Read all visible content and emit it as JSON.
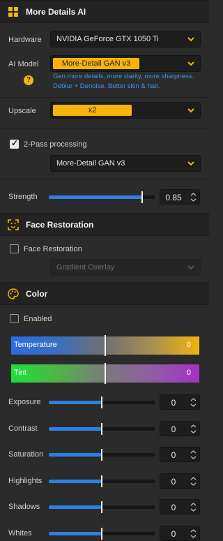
{
  "sections": {
    "details": {
      "title": "More Details AI",
      "icon": "grid-icon"
    },
    "face": {
      "title": "Face Restoration",
      "icon": "face-scan-icon"
    },
    "color": {
      "title": "Color",
      "icon": "palette-icon"
    }
  },
  "hardware": {
    "label": "Hardware",
    "value": "NVIDIA GeForce GTX 1050 Ti"
  },
  "ai_model": {
    "label": "AI Model",
    "value": "More-Detail GAN  v3",
    "hint_line1": "Gen more details, more clarity, more sharpness.",
    "hint_line2": "Deblur + Denoise. Better skin & hair.",
    "help": "?"
  },
  "upscale": {
    "label": "Upscale",
    "value": "x2"
  },
  "two_pass": {
    "label": "2-Pass processing",
    "checked": true,
    "model": "More-Detail GAN  v3"
  },
  "strength": {
    "label": "Strength",
    "value": "0.85",
    "level": 0.85
  },
  "face_restoration": {
    "label": "Face Restoration",
    "checked": false,
    "mode": "Gradient Overlay"
  },
  "color": {
    "enabled_label": "Enabled",
    "temperature": {
      "label": "Temperature",
      "value": "0"
    },
    "tint": {
      "label": "Tint",
      "value": "0"
    },
    "sliders": [
      {
        "label": "Exposure",
        "value": "0",
        "level": 0.5
      },
      {
        "label": "Contrast",
        "value": "0",
        "level": 0.5
      },
      {
        "label": "Saturation",
        "value": "0",
        "level": 0.5
      },
      {
        "label": "Highlights",
        "value": "0",
        "level": 0.5
      },
      {
        "label": "Shadows",
        "value": "0",
        "level": 0.5
      },
      {
        "label": "Whites",
        "value": "0",
        "level": 0.5
      }
    ]
  },
  "colors": {
    "accent": "#f5b40c",
    "slider": "#2d80e6",
    "hint": "#3d95e8"
  }
}
